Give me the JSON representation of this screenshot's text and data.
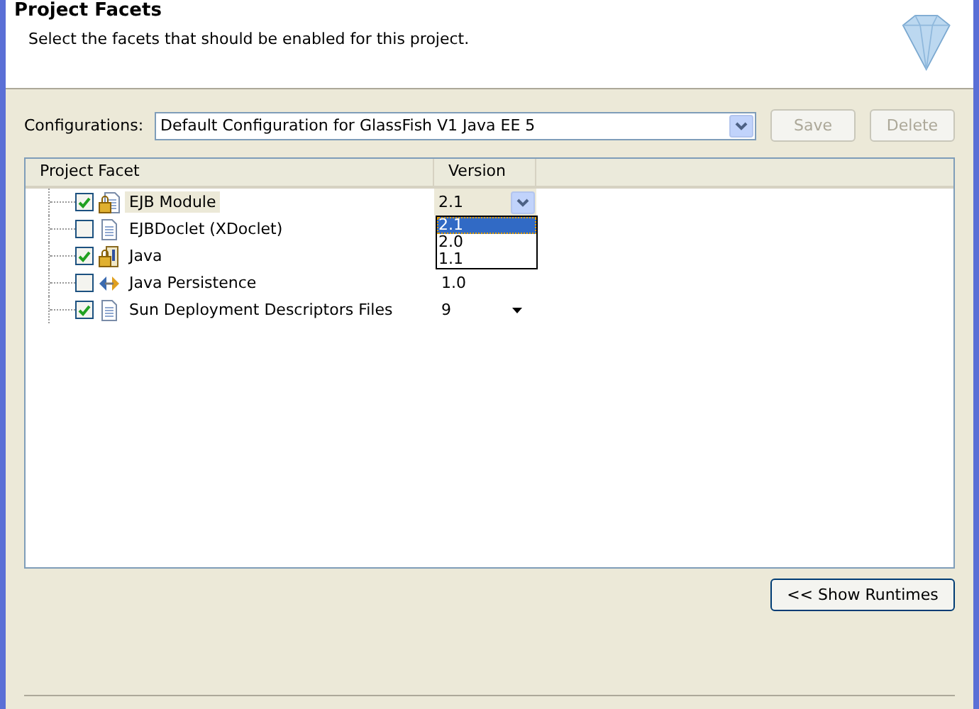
{
  "header": {
    "title": "Project Facets",
    "description": "Select the facets that should be enabled for this project."
  },
  "configuration": {
    "label": "Configurations:",
    "value": "Default Configuration for GlassFish V1 Java EE 5",
    "buttons": [
      {
        "label": "Save",
        "disabled": true
      },
      {
        "label": "Delete",
        "disabled": true
      }
    ]
  },
  "table": {
    "columns": [
      "Project Facet",
      "Version"
    ],
    "rows": [
      {
        "name": "EJB Module",
        "checked": true,
        "selected": true,
        "kind": "combo",
        "version": "2.1"
      },
      {
        "name": "EJBDoclet (XDoclet)",
        "checked": false,
        "selected": false,
        "kind": "none"
      },
      {
        "name": "Java",
        "checked": true,
        "selected": false,
        "kind": "none"
      },
      {
        "name": "Java Persistence",
        "checked": false,
        "selected": false,
        "kind": "text",
        "version": "1.0"
      },
      {
        "name": "Sun Deployment Descriptors Files",
        "checked": true,
        "selected": false,
        "kind": "menu",
        "version": "9"
      }
    ]
  },
  "version_menu": {
    "options": [
      {
        "label": "2.1",
        "selected": true
      },
      {
        "label": "2.0",
        "selected": false
      },
      {
        "label": "1.1",
        "selected": false
      }
    ]
  },
  "show_runtimes_button": "<< Show Runtimes"
}
